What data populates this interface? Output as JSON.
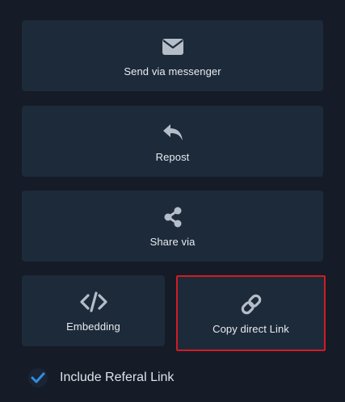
{
  "share_options": {
    "messenger": {
      "label": "Send via messenger",
      "icon": "envelope-icon"
    },
    "repost": {
      "label": "Repost",
      "icon": "reply-arrow-icon"
    },
    "share_via": {
      "label": "Share via",
      "icon": "share-icon"
    },
    "embedding": {
      "label": "Embedding",
      "icon": "code-icon"
    },
    "copy_link": {
      "label": "Copy direct Link",
      "icon": "link-icon"
    }
  },
  "referral": {
    "label": "Include Referal Link",
    "checked": true
  },
  "colors": {
    "background": "#151b27",
    "tile": "#1d2a3a",
    "icon": "#b5bdc8",
    "highlight_border": "#d01c24",
    "check_accent": "#2f8de4"
  }
}
